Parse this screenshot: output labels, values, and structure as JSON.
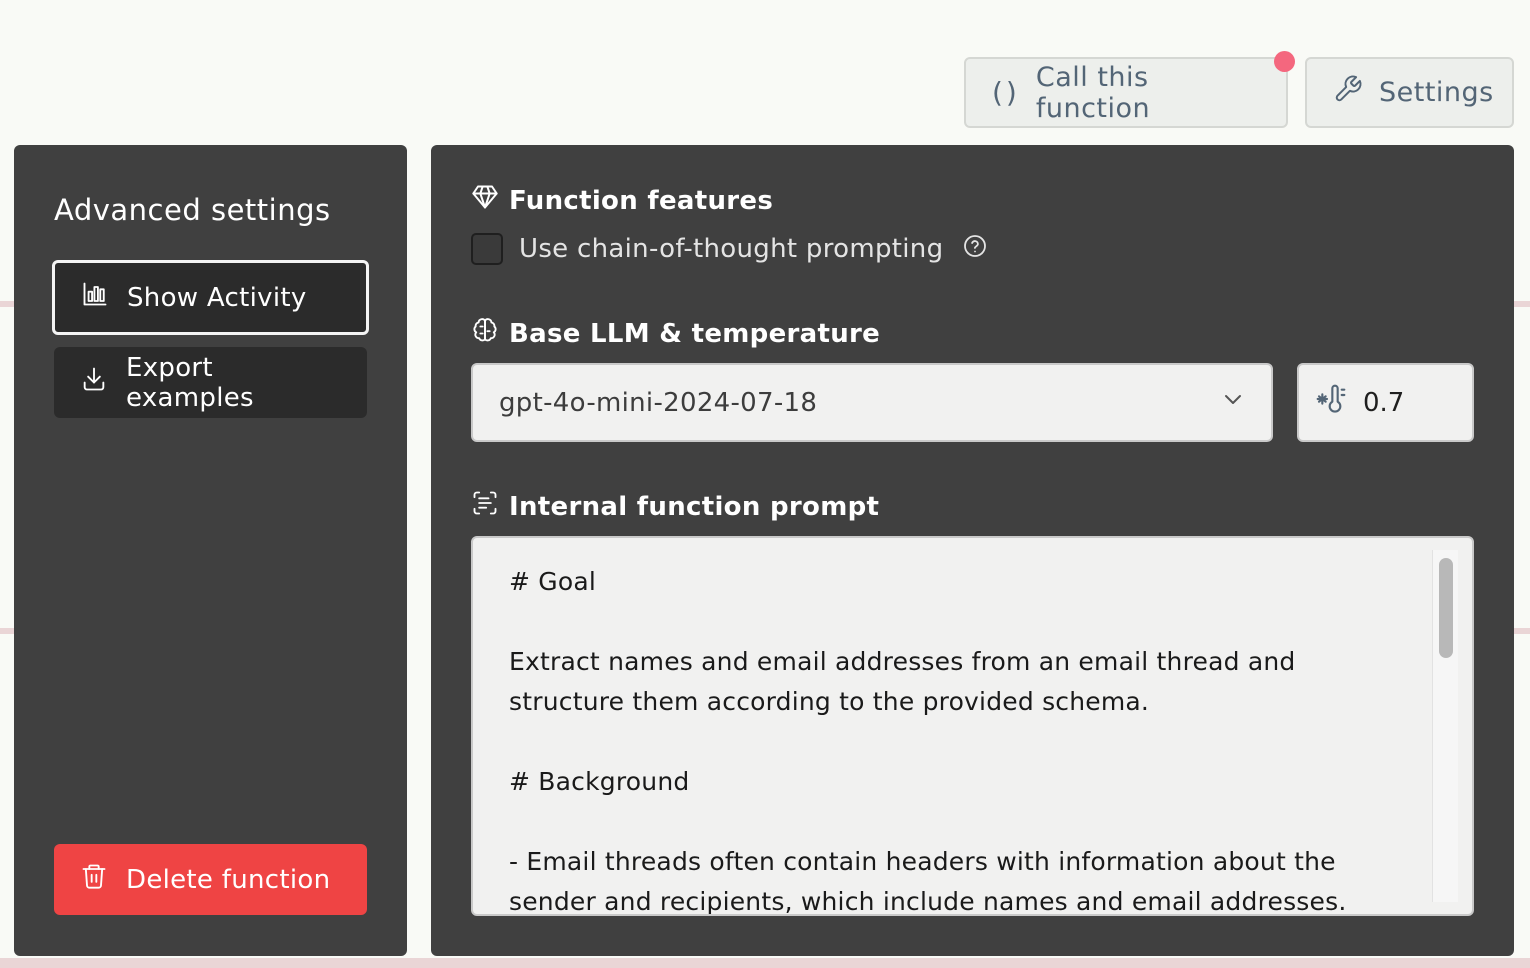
{
  "header": {
    "call_label": "Call this function",
    "call_icon": "()",
    "settings_label": "Settings"
  },
  "sidebar": {
    "title": "Advanced settings",
    "show_activity_label": "Show Activity",
    "export_label": "Export examples",
    "delete_label": "Delete function"
  },
  "features": {
    "title": "Function features",
    "cot_label": "Use chain-of-thought prompting",
    "cot_checked": false
  },
  "llm": {
    "title": "Base LLM & temperature",
    "model_value": "gpt-4o-mini-2024-07-18",
    "temperature": "0.7"
  },
  "prompt": {
    "title": "Internal function prompt",
    "text": "# Goal\n\nExtract names and email addresses from an email thread and\nstructure them according to the provided schema.\n\n# Background\n\n- Email threads often contain headers with information about the\nsender and recipients, which include names and email addresses."
  },
  "colors": {
    "delete": "#ef4444",
    "notification": "#f4677e",
    "panel": "#404040"
  }
}
